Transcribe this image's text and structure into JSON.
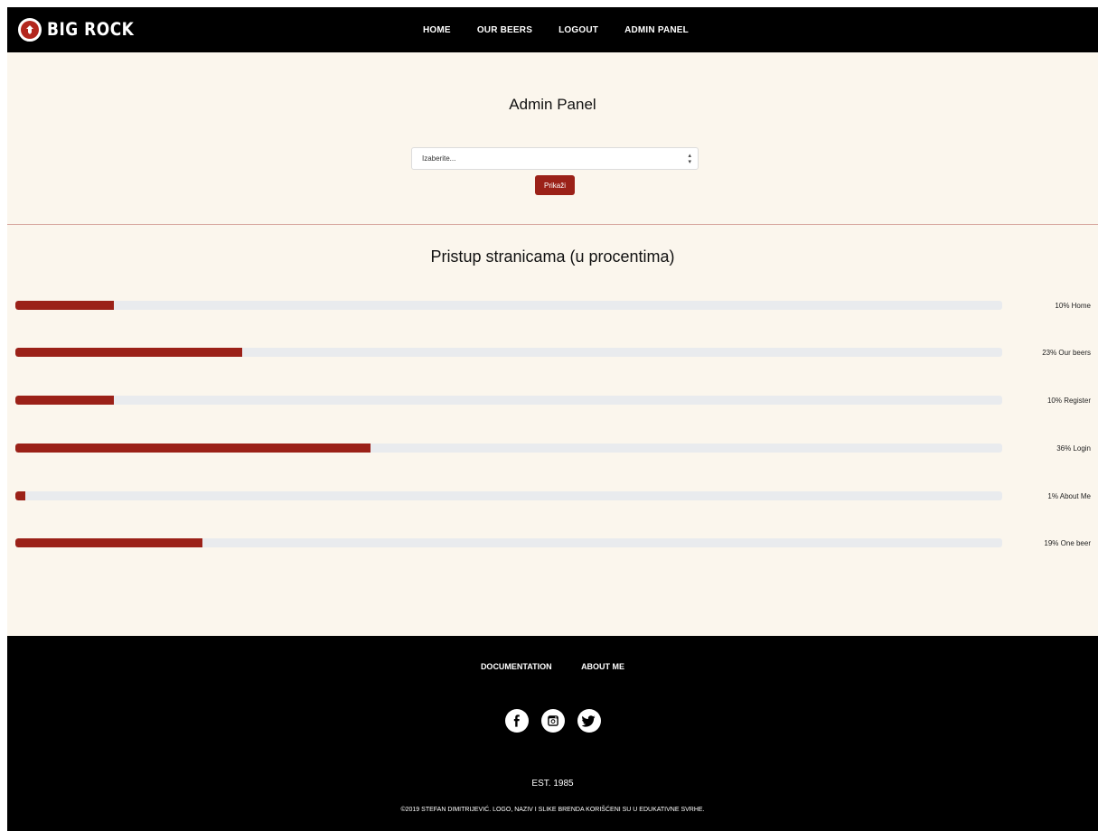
{
  "header": {
    "logo_text": "BIG ROCK",
    "nav": [
      "HOME",
      "OUR BEERS",
      "LOGOUT",
      "ADMIN PANEL"
    ]
  },
  "admin": {
    "title": "Admin Panel",
    "select_value": "Izaberite...",
    "show_button": "Prikaži"
  },
  "stats": {
    "title": "Pristup stranicama (u procentima)",
    "items": [
      {
        "label": "10% Home",
        "percent": 10
      },
      {
        "label": "23% Our beers",
        "percent": 23
      },
      {
        "label": "10% Register",
        "percent": 10
      },
      {
        "label": "36% Login",
        "percent": 36
      },
      {
        "label": "1% About Me",
        "percent": 1
      },
      {
        "label": "19% One beer",
        "percent": 19
      }
    ]
  },
  "footer": {
    "nav": [
      "DOCUMENTATION",
      "ABOUT ME"
    ],
    "social_icons": [
      "facebook-icon",
      "instagram-icon",
      "twitter-icon"
    ],
    "est": "EST. 1985",
    "copyright": "©2019 STEFAN DIMITRIJEVIĆ. LOGO, NAZIV I SLIKE BRENDA KORIŠĆENI SU U EDUKATIVNE SVRHE."
  },
  "colors": {
    "accent": "#9b2118",
    "background": "#fbf6ed",
    "header": "#000000",
    "track": "#e9ebee"
  }
}
